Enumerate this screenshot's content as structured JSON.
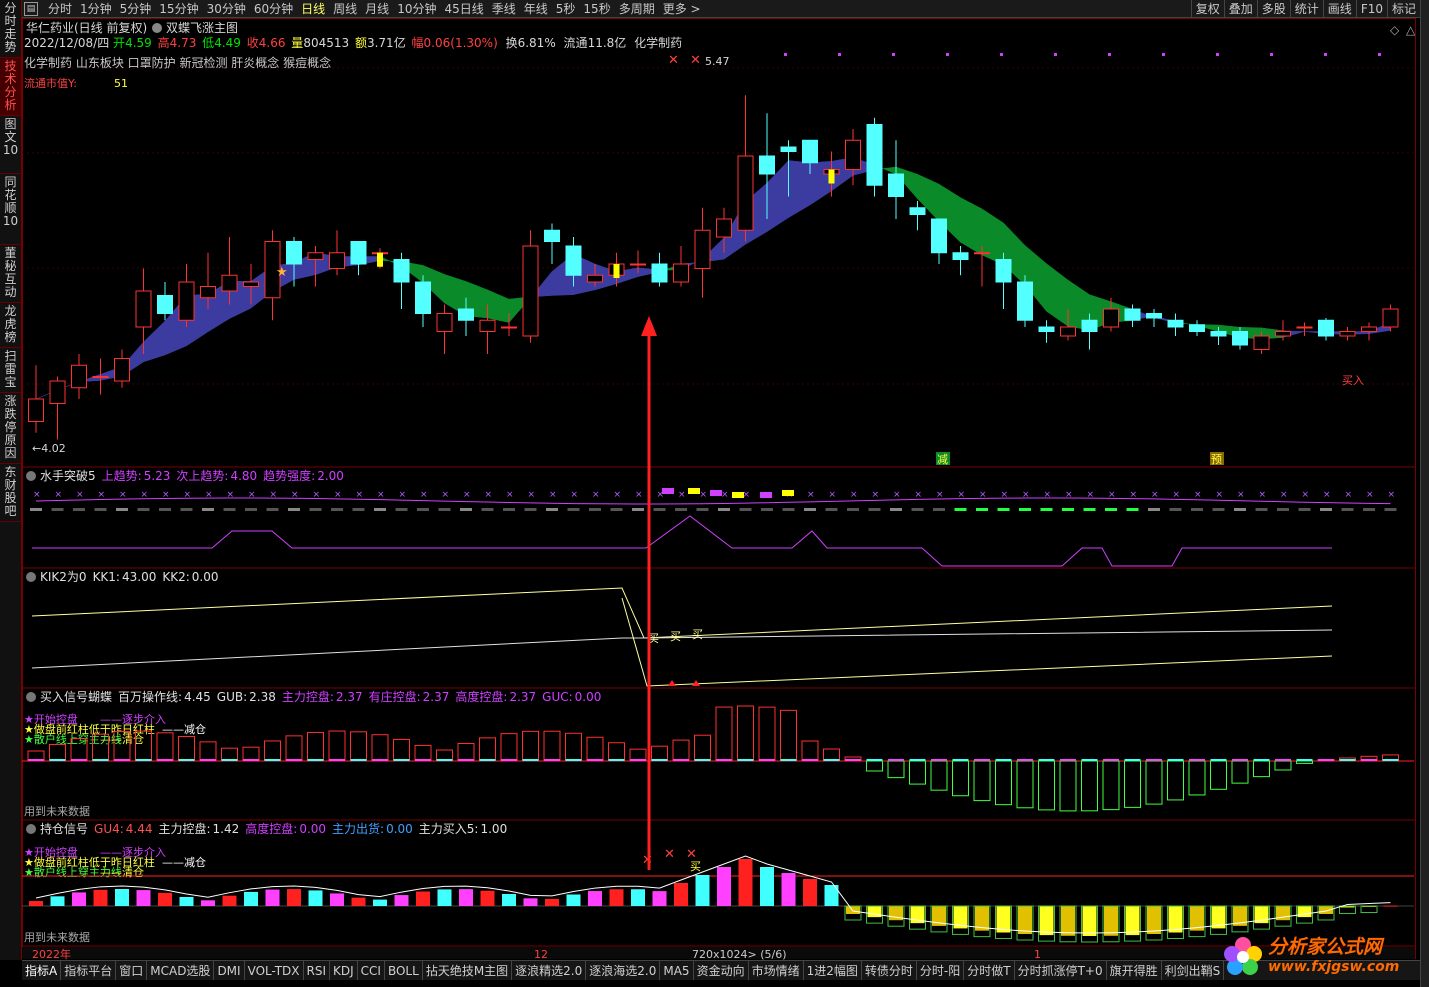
{
  "topbar": {
    "periods": [
      "分时",
      "1分钟",
      "5分钟",
      "15分钟",
      "30分钟",
      "60分钟",
      "日线",
      "周线",
      "月线",
      "10分钟",
      "45日线",
      "季线",
      "年线",
      "5秒",
      "15秒",
      "多周期",
      "更多 >"
    ],
    "active_period": "日线",
    "right_buttons": [
      "复权",
      "叠加",
      "多股",
      "统计",
      "画线",
      "F10",
      "标记"
    ]
  },
  "left_tabs": [
    {
      "label": "分时走势",
      "active": false
    },
    {
      "label": "技术分析",
      "active": true
    },
    {
      "label": "图文10",
      "active": false
    },
    {
      "label": "同花顺10",
      "active": false
    },
    {
      "label": "董秘互动",
      "active": false
    },
    {
      "label": "龙虎榜",
      "active": false
    },
    {
      "label": "扫雷宝",
      "active": false
    },
    {
      "label": "涨跌停原因",
      "active": false
    },
    {
      "label": "东财股吧",
      "active": false
    }
  ],
  "header": {
    "stock": "华仁药业(日线 前复权)",
    "formula": "双蝶飞涨主图",
    "date": "2022/12/08/四",
    "open_label": "开",
    "open": "4.59",
    "high_label": "高",
    "high": "4.73",
    "low_label": "低",
    "low": "4.49",
    "close_label": "收",
    "close": "4.66",
    "vol_label": "量",
    "vol": "804513",
    "amt_label": "额",
    "amt": "3.71亿",
    "chg_label": "幅",
    "chg": "0.06(1.30%)",
    "turn_label": "换",
    "turn": "6.81%",
    "float_label": "流通",
    "float": "11.8亿",
    "industry": "化学制药",
    "concepts": "化学制药 山东板块 口罩防护 新冠检测 肝炎概念 猴痘概念",
    "mcap_label": "流通市值Y:",
    "mcap": "51"
  },
  "main_annotations": {
    "high_price": "5.47",
    "low_price": "←4.02",
    "buy_label": "买入",
    "reduce_label": "减",
    "pre_label": "预"
  },
  "panel1": {
    "name": "水手突破5",
    "items": [
      {
        "label": "上趋势:",
        "value": "5.23",
        "color": "#d040ff"
      },
      {
        "label": "次上趋势:",
        "value": "4.80",
        "color": "#d040ff"
      },
      {
        "label": "趋势强度:",
        "value": "2.00",
        "color": "#d040ff"
      }
    ]
  },
  "panel2": {
    "name": "KIK2为0",
    "items": [
      {
        "label": "KK1:",
        "value": "43.00",
        "color": "#e0e0e0"
      },
      {
        "label": "KK2:",
        "value": "0.00",
        "color": "#e0e0e0"
      }
    ],
    "buy_marks": [
      "买",
      "买",
      "买"
    ]
  },
  "panel3": {
    "name": "买入信号蝴蝶",
    "items": [
      {
        "label": "百万操作线:",
        "value": "4.45",
        "color": "#e0e0e0"
      },
      {
        "label": "GUB:",
        "value": "2.38",
        "color": "#e0e0e0"
      },
      {
        "label": "主力控盘:",
        "value": "2.37",
        "color": "#d040ff"
      },
      {
        "label": "有庄控盘:",
        "value": "2.37",
        "color": "#d040ff"
      },
      {
        "label": "高度控盘:",
        "value": "2.37",
        "color": "#d040ff"
      },
      {
        "label": "GUC:",
        "value": "0.00",
        "color": "#d040ff"
      }
    ],
    "legend": {
      "l1a": "★开始控盘",
      "l1b": "——逐步介入",
      "l2a": "★做盘前红柱低于昨日红柱",
      "l2b": "——减仓",
      "l3a": "★散户线上穿主力线",
      "l3b": "——清仓"
    },
    "note": "用到未来数据"
  },
  "panel4": {
    "name": "持仓信号",
    "items": [
      {
        "label": "GU4:",
        "value": "4.44",
        "color": "#ff5050"
      },
      {
        "label": "主力控盘:",
        "value": "1.42",
        "color": "#e0e0e0"
      },
      {
        "label": "高度控盘:",
        "value": "0.00",
        "color": "#d040ff"
      },
      {
        "label": "主力出货:",
        "value": "0.00",
        "color": "#40a0ff"
      },
      {
        "label": "主力买入5:",
        "value": "1.00",
        "color": "#e0e0e0"
      }
    ],
    "legend": {
      "l1a": "★开始控盘",
      "l1b": "——逐步介入",
      "l2a": "★做盘前红柱低于昨日红柱",
      "l2b": "——减仓",
      "l3a": "★散户线上穿主力线",
      "l3b": "——清仓"
    },
    "note": "用到未来数据",
    "buy_mark": "买"
  },
  "xaxis": {
    "year": "2022年",
    "month12": "12",
    "month1": "1",
    "size_info": "720x1024> (5/6)"
  },
  "bottombar": {
    "items": [
      "指标A",
      "指标平台",
      "窗口",
      "MCAD选股",
      "DMI",
      "VOL-TDX",
      "RSI",
      "KDJ",
      "CCI",
      "BOLL",
      "拈天绝技M主图",
      "逐浪精选2.0",
      "逐浪海选2.0",
      "MA5",
      "资金动向",
      "市场情绪",
      "1进2幅图",
      "转债分时",
      "分时-阳",
      "分时做T",
      "分时抓涨停T+0",
      "旗开得胜",
      "利剑出鞘S"
    ]
  },
  "logo": {
    "name": "分析家公式网",
    "url": "www.fxjgsw.com"
  },
  "colors": {
    "up": "#ff3232",
    "down": "#54ffff",
    "blue_band": "#3c3ca0",
    "green_band": "#0a8a28",
    "magenta": "#d040ff",
    "yellow": "#ffff00"
  },
  "chart_data": {
    "type": "candlestick",
    "candles": [
      [
        4.1,
        4.2,
        4.35,
        4.05
      ],
      [
        4.18,
        4.28,
        4.3,
        4.02
      ],
      [
        4.25,
        4.35,
        4.4,
        4.2
      ],
      [
        4.3,
        4.3,
        4.38,
        4.22
      ],
      [
        4.28,
        4.38,
        4.42,
        4.25
      ],
      [
        4.52,
        4.68,
        4.78,
        4.4
      ],
      [
        4.66,
        4.58,
        4.72,
        4.55
      ],
      [
        4.55,
        4.72,
        4.8,
        4.52
      ],
      [
        4.65,
        4.7,
        4.85,
        4.6
      ],
      [
        4.68,
        4.75,
        4.92,
        4.62
      ],
      [
        4.7,
        4.72,
        4.8,
        4.62
      ],
      [
        4.65,
        4.9,
        4.95,
        4.55
      ],
      [
        4.9,
        4.8,
        4.92,
        4.7
      ],
      [
        4.82,
        4.85,
        4.88,
        4.7
      ],
      [
        4.78,
        4.85,
        4.95,
        4.75
      ],
      [
        4.9,
        4.8,
        4.9,
        4.75
      ],
      [
        4.85,
        4.85,
        4.87,
        4.78
      ],
      [
        4.82,
        4.72,
        4.85,
        4.6
      ],
      [
        4.72,
        4.58,
        4.75,
        4.52
      ],
      [
        4.5,
        4.58,
        4.62,
        4.4
      ],
      [
        4.6,
        4.55,
        4.65,
        4.48
      ],
      [
        4.5,
        4.55,
        4.62,
        4.4
      ],
      [
        4.52,
        4.52,
        4.58,
        4.48
      ],
      [
        4.48,
        4.88,
        4.95,
        4.45
      ],
      [
        4.95,
        4.9,
        4.98,
        4.8
      ],
      [
        4.88,
        4.75,
        4.92,
        4.7
      ],
      [
        4.72,
        4.75,
        4.8,
        4.7
      ],
      [
        4.75,
        4.8,
        4.85,
        4.7
      ],
      [
        4.8,
        4.8,
        4.86,
        4.76
      ],
      [
        4.8,
        4.72,
        4.85,
        4.7
      ],
      [
        4.72,
        4.8,
        4.88,
        4.7
      ],
      [
        4.78,
        4.95,
        5.05,
        4.65
      ],
      [
        4.92,
        5.0,
        5.05,
        4.85
      ],
      [
        4.95,
        5.28,
        5.55,
        4.9
      ],
      [
        5.28,
        5.2,
        5.47,
        5.0
      ],
      [
        5.32,
        5.3,
        5.35,
        5.1
      ],
      [
        5.35,
        5.25,
        5.35,
        5.2
      ],
      [
        5.2,
        5.22,
        5.3,
        5.1
      ],
      [
        5.22,
        5.35,
        5.4,
        5.15
      ],
      [
        5.42,
        5.15,
        5.45,
        5.1
      ],
      [
        5.2,
        5.1,
        5.35,
        5.0
      ],
      [
        5.05,
        5.02,
        5.08,
        4.95
      ],
      [
        5.0,
        4.85,
        5.0,
        4.8
      ],
      [
        4.85,
        4.82,
        4.88,
        4.75
      ],
      [
        4.85,
        4.85,
        4.88,
        4.7
      ],
      [
        4.82,
        4.72,
        4.85,
        4.6
      ],
      [
        4.72,
        4.55,
        4.75,
        4.52
      ],
      [
        4.52,
        4.5,
        4.55,
        4.45
      ],
      [
        4.48,
        4.52,
        4.6,
        4.46
      ],
      [
        4.55,
        4.5,
        4.58,
        4.42
      ],
      [
        4.52,
        4.6,
        4.65,
        4.5
      ],
      [
        4.6,
        4.55,
        4.62,
        4.52
      ],
      [
        4.58,
        4.56,
        4.6,
        4.52
      ],
      [
        4.55,
        4.52,
        4.58,
        4.48
      ],
      [
        4.53,
        4.5,
        4.55,
        4.48
      ],
      [
        4.5,
        4.48,
        4.52,
        4.44
      ],
      [
        4.5,
        4.44,
        4.52,
        4.42
      ],
      [
        4.42,
        4.48,
        4.5,
        4.4
      ],
      [
        4.48,
        4.5,
        4.55,
        4.46
      ],
      [
        4.52,
        4.52,
        4.54,
        4.48
      ],
      [
        4.55,
        4.48,
        4.56,
        4.46
      ],
      [
        4.48,
        4.5,
        4.52,
        4.46
      ],
      [
        4.5,
        4.52,
        4.54,
        4.46
      ],
      [
        4.52,
        4.6,
        4.62,
        4.5
      ]
    ],
    "price_range": [
      4.0,
      5.6
    ]
  }
}
